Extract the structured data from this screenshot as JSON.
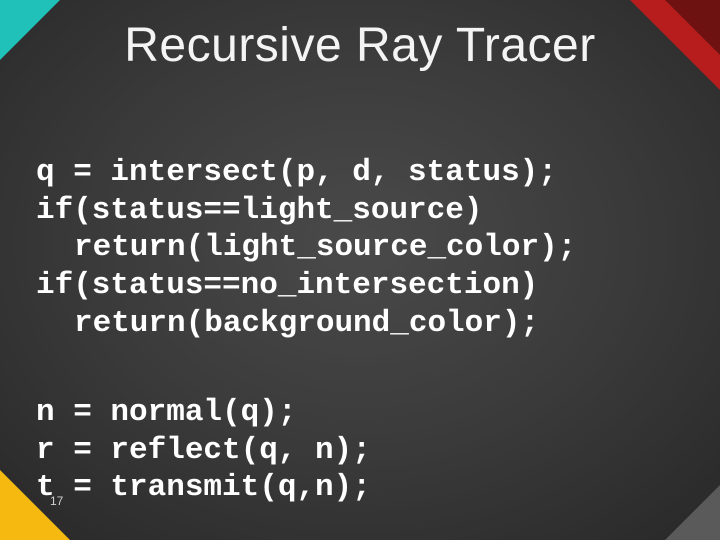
{
  "slide": {
    "title": "Recursive Ray Tracer",
    "number": "17"
  },
  "code": {
    "block1": {
      "l1": "q = intersect(p, d, status);",
      "l2": "if(status==light_source)",
      "l3": "return(light_source_color);",
      "l4": "if(status==no_intersection)",
      "l5": "return(background_color);"
    },
    "block2": {
      "l1": "n = normal(q);",
      "l2": "r = reflect(q, n);",
      "l3": "t = transmit(q,n);"
    }
  },
  "colors": {
    "corner_tl": "#1fc1b9",
    "corner_tr": "#b81d1d",
    "corner_bl": "#f5b90f",
    "corner_br": "#5a5a5a"
  }
}
